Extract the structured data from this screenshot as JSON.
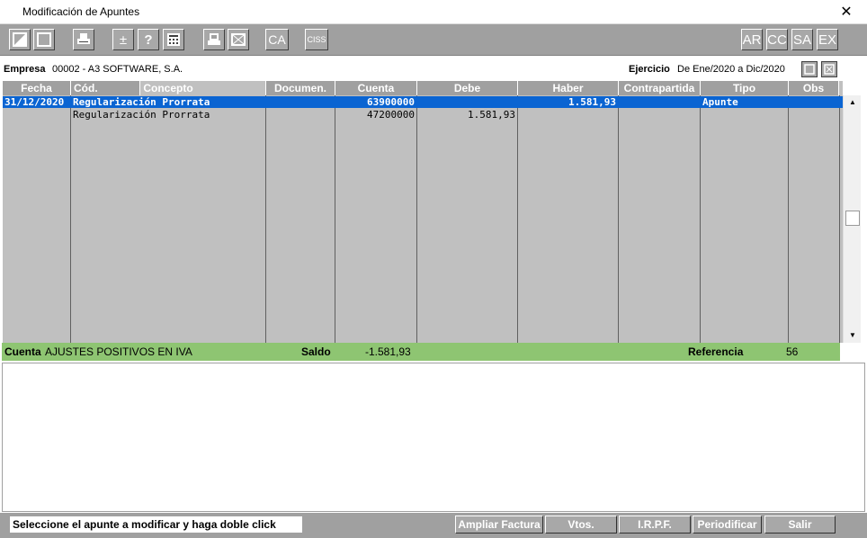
{
  "window": {
    "title": "Modificación de Apuntes",
    "close_glyph": "✕"
  },
  "toolbar": {
    "left_buttons": [
      {
        "icon": "half-square-icon",
        "glyph": "◩"
      },
      {
        "icon": "square-icon",
        "glyph": "☐"
      },
      {
        "icon": "printer-icon",
        "glyph": "🖶"
      },
      {
        "icon": "plus-minus-icon",
        "glyph": "±"
      },
      {
        "icon": "help-icon",
        "glyph": "?"
      },
      {
        "icon": "calculator-icon",
        "glyph": "▦"
      },
      {
        "icon": "print-document-icon",
        "glyph": "▤"
      },
      {
        "icon": "image-document-icon",
        "glyph": "⊠"
      }
    ],
    "ca_label": "CA",
    "ciss_label": "CISS",
    "right_buttons": [
      "AR",
      "CC",
      "SA",
      "EX"
    ]
  },
  "info": {
    "empresa_label": "Empresa",
    "empresa_value": "00002 - A3 SOFTWARE, S.A.",
    "ejercicio_label": "Ejercicio",
    "ejercicio_value": "De Ene/2020 a Dic/2020"
  },
  "grid": {
    "headers": [
      "Fecha",
      "Cód.",
      "Concepto",
      "Documen.",
      "Cuenta",
      "Debe",
      "Haber",
      "Contrapartida",
      "Tipo",
      "Obs"
    ],
    "rows": [
      {
        "fecha": "31/12/2020",
        "cod": "",
        "concepto": "Regularización Prorrata",
        "documento": "",
        "cuenta": "63900000",
        "debe": "",
        "haber": "1.581,93",
        "contrapartida": "",
        "tipo": "Apunte",
        "obs": ""
      },
      {
        "fecha": "",
        "cod": "",
        "concepto": "Regularización Prorrata",
        "documento": "",
        "cuenta": "47200000",
        "debe": "1.581,93",
        "haber": "",
        "contrapartida": "",
        "tipo": "",
        "obs": ""
      }
    ]
  },
  "status": {
    "cuenta_label": "Cuenta",
    "cuenta_value": "AJUSTES POSITIVOS EN IVA",
    "saldo_label": "Saldo",
    "saldo_value": "-1.581,93",
    "referencia_label": "Referencia",
    "referencia_value": "56"
  },
  "footer": {
    "hint": "Seleccione el apunte a modificar y haga doble click",
    "buttons": [
      "Ampliar Factura",
      "Vtos.",
      "I.R.P.F.",
      "Periodificar",
      "Salir"
    ]
  },
  "colors": {
    "toolbar": "#a0a0a0",
    "grid_bg": "#c0c0c0",
    "selection": "#0a64d2",
    "status_band": "#8ec572"
  }
}
